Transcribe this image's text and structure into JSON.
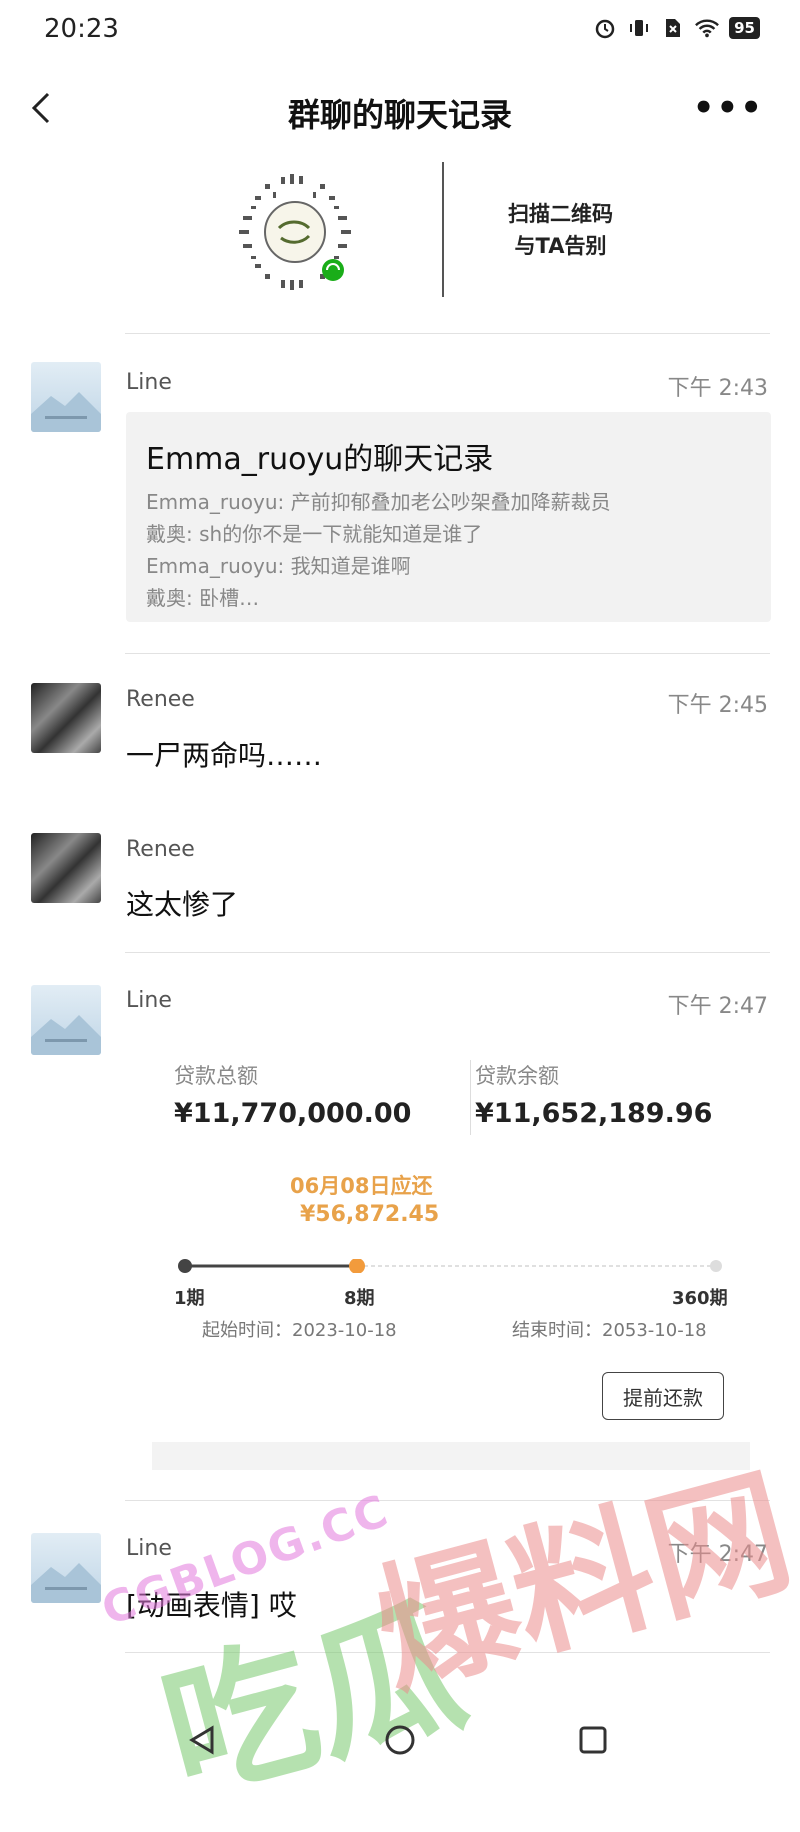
{
  "status_bar": {
    "time": "20:23",
    "battery": "95"
  },
  "header": {
    "title": "群聊的聊天记录"
  },
  "qr_banner": {
    "line1": "扫描二维码",
    "line2": "与TA告别"
  },
  "messages": [
    {
      "sender": "Line",
      "time": "下午 2:43",
      "record": {
        "title": "Emma_ruoyu的聊天记录",
        "lines": [
          "Emma_ruoyu: 产前抑郁叠加老公吵架叠加降薪裁员",
          "戴奥: sh的你不是一下就能知道是谁了",
          "Emma_ruoyu: 我知道是谁啊",
          "戴奥: 卧槽…"
        ]
      }
    },
    {
      "sender": "Renee",
      "time": "下午 2:45",
      "text": "一尸两命吗……"
    },
    {
      "sender": "Renee",
      "text": "这太惨了"
    },
    {
      "sender": "Line",
      "time": "下午 2:47",
      "loan": {
        "total_label": "贷款总额",
        "total_value": "¥11,770,000.00",
        "remain_label": "贷款余额",
        "remain_value": "¥11,652,189.96",
        "due_date": "06月08日应还",
        "due_amount": "¥56,872.45",
        "period_start": "1期",
        "period_current": "8期",
        "period_end": "360期",
        "start_time": "起始时间：2023-10-18",
        "end_time": "结束时间：2053-10-18",
        "prepay_button": "提前还款"
      }
    },
    {
      "sender": "Line",
      "time": "下午 2:47",
      "text": "[动画表情] 哎"
    }
  ],
  "watermark": {
    "english": "CGBLOG.CC",
    "chinese_left": "吃瓜",
    "chinese_right": "爆料网"
  }
}
